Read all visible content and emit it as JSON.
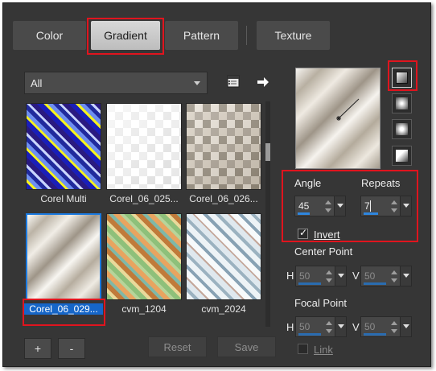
{
  "tabs": [
    {
      "label": "Color"
    },
    {
      "label": "Gradient"
    },
    {
      "label": "Pattern"
    },
    {
      "label": "Texture"
    }
  ],
  "active_tab": "Gradient",
  "category_select": {
    "value": "All"
  },
  "gradients": [
    {
      "label": "Corel Multi"
    },
    {
      "label": "Corel_06_025..."
    },
    {
      "label": "Corel_06_026..."
    },
    {
      "label": "Corel_06_029...",
      "selected": true
    },
    {
      "label": "cvm_1204"
    },
    {
      "label": "cvm_2024"
    }
  ],
  "settings": {
    "angle_label": "Angle",
    "angle_value": "45",
    "repeats_label": "Repeats",
    "repeats_value": "7",
    "invert_label": "Invert",
    "invert_checked": true
  },
  "center_point": {
    "title": "Center Point",
    "h_label": "H",
    "h_value": "50",
    "v_label": "V",
    "v_value": "50"
  },
  "focal_point": {
    "title": "Focal Point",
    "h_label": "H",
    "h_value": "50",
    "v_label": "V",
    "v_value": "50",
    "link_label": "Link",
    "link_checked": false
  },
  "bottom": {
    "add_label": "+",
    "remove_label": "-",
    "reset_label": "Reset",
    "save_label": "Save"
  },
  "colors": {
    "highlight": "#e0141e",
    "selection": "#1666c8",
    "panel": "#363636"
  }
}
